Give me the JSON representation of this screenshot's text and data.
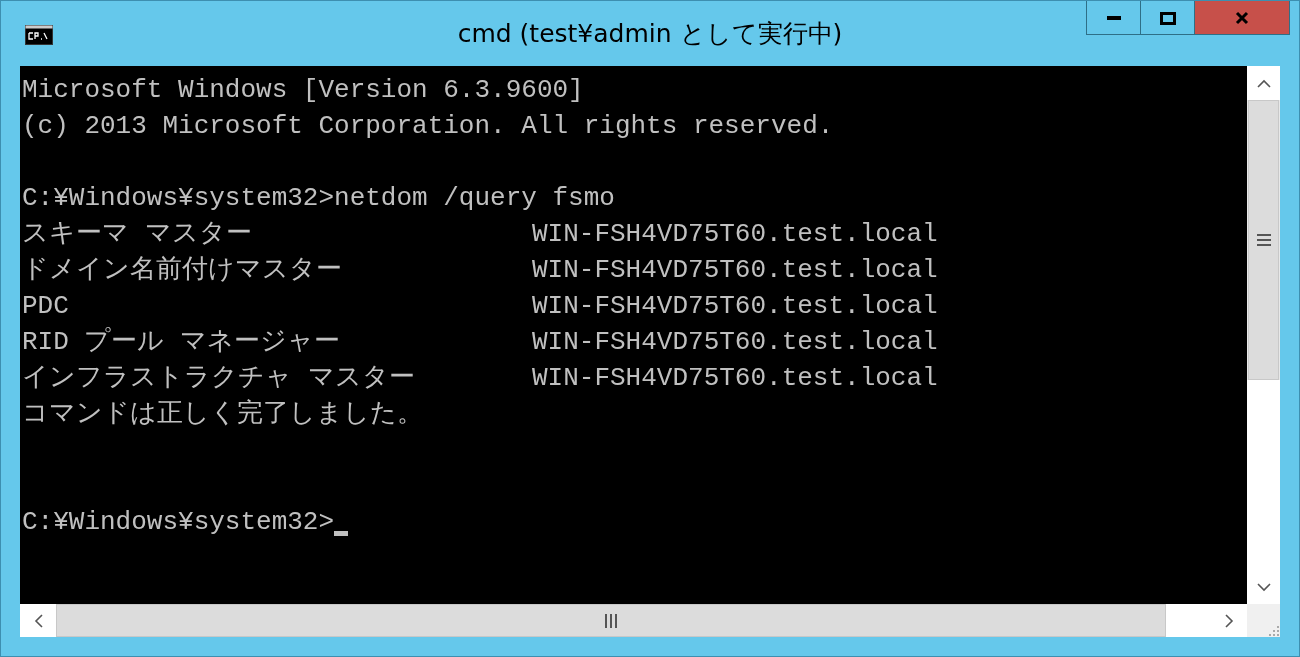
{
  "window": {
    "title": "cmd (test¥admin として実行中)"
  },
  "console": {
    "lines": [
      {
        "kind": "output",
        "text": "Microsoft Windows [Version 6.3.9600]"
      },
      {
        "kind": "output",
        "text": "(c) 2013 Microsoft Corporation. All rights reserved."
      },
      {
        "kind": "blank"
      },
      {
        "kind": "output",
        "text": "C:¥Windows¥system32>netdom /query fsmo"
      },
      {
        "kind": "row",
        "role": "スキーマ マスター",
        "server": "WIN-FSH4VD75T60.test.local"
      },
      {
        "kind": "row",
        "role": "ドメイン名前付けマスター",
        "server": "WIN-FSH4VD75T60.test.local"
      },
      {
        "kind": "row",
        "role": "PDC",
        "server": "WIN-FSH4VD75T60.test.local"
      },
      {
        "kind": "row",
        "role": "RID プール マネージャー",
        "server": "WIN-FSH4VD75T60.test.local"
      },
      {
        "kind": "row",
        "role": "インフラストラクチャ マスター",
        "server": "WIN-FSH4VD75T60.test.local"
      },
      {
        "kind": "output",
        "text": "コマンドは正しく完了しました。"
      },
      {
        "kind": "blank"
      },
      {
        "kind": "blank"
      },
      {
        "kind": "prompt",
        "text": "C:¥Windows¥system32>",
        "cursor": true
      }
    ]
  }
}
